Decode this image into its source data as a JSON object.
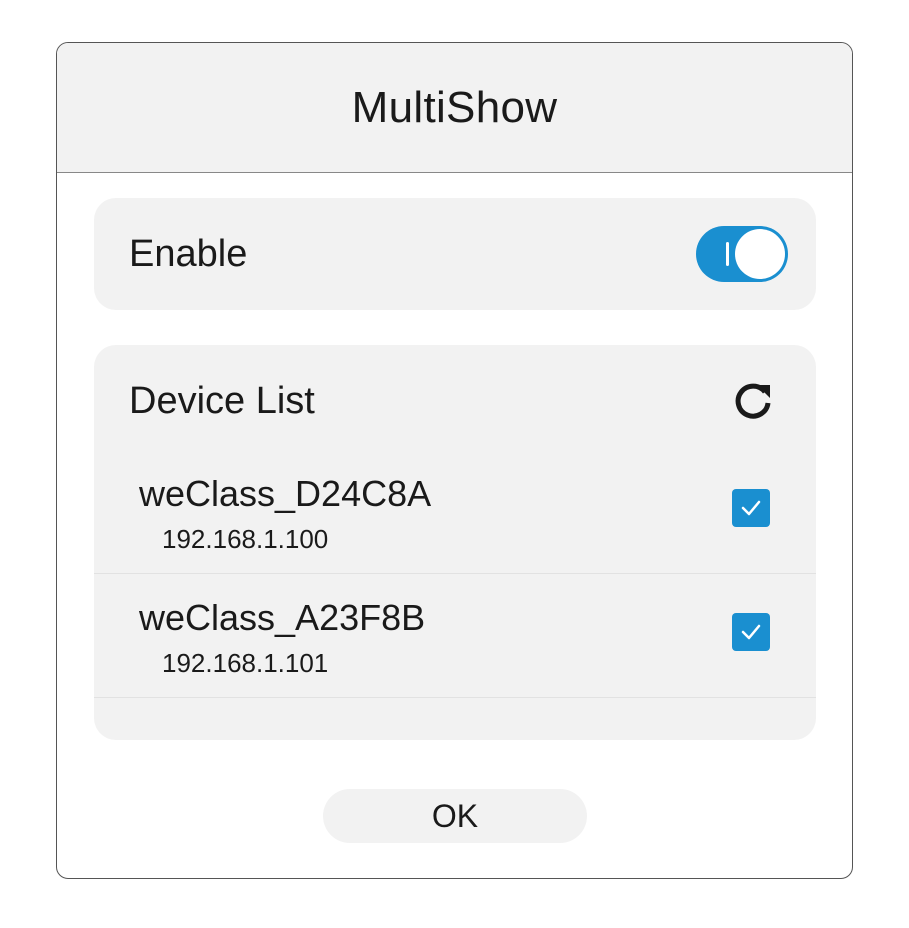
{
  "dialog": {
    "title": "MultiShow"
  },
  "enable": {
    "label": "Enable",
    "toggle_on": true
  },
  "devices": {
    "title": "Device List",
    "refresh_icon": "refresh-icon",
    "items": [
      {
        "name": "weClass_D24C8A",
        "ip": "192.168.1.100",
        "checked": true
      },
      {
        "name": "weClass_A23F8B",
        "ip": "192.168.1.101",
        "checked": true
      }
    ]
  },
  "footer": {
    "ok_label": "OK"
  },
  "colors": {
    "accent": "#1a8fd0",
    "panel": "#f2f2f2",
    "border": "#555555"
  }
}
